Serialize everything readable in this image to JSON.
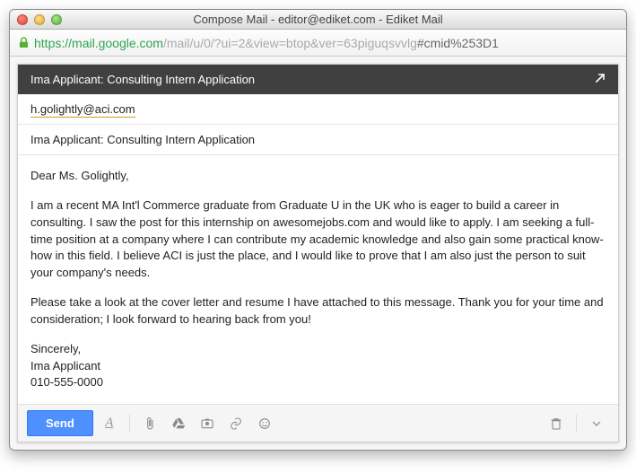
{
  "window": {
    "title": "Compose Mail - editor@ediket.com - Ediket Mail"
  },
  "url": {
    "scheme": "https",
    "host": "://mail.google.com",
    "path": "/mail/u/0/?ui=2&view=btop&ver=63piguqsvvlg",
    "fragment": "#cmid%253D1"
  },
  "compose": {
    "header_title": "Ima Applicant: Consulting Intern Application",
    "to": "h.golightly@aci.com",
    "subject": "Ima Applicant: Consulting Intern Application",
    "body": {
      "salutation": "Dear Ms. Golightly,",
      "p1": "I am a recent MA Int'l Commerce graduate from Graduate U in the UK who is eager to build a career in consulting. I saw the post for this internship on awesomejobs.com and would like to apply. I am seeking a full-time position at a company where I can contribute my academic knowledge and also gain some practical know-how in this field. I believe ACI is just the place, and I would like to prove that I am also just the person to suit your company's needs.",
      "p2": "Please take a look at the cover letter and resume I have attached to this message. Thank you for your time and consideration; I look forward to hearing back from you!",
      "closing": "Sincerely,",
      "name": "Ima Applicant",
      "phone": "010-555-0000"
    }
  },
  "toolbar": {
    "send_label": "Send"
  }
}
